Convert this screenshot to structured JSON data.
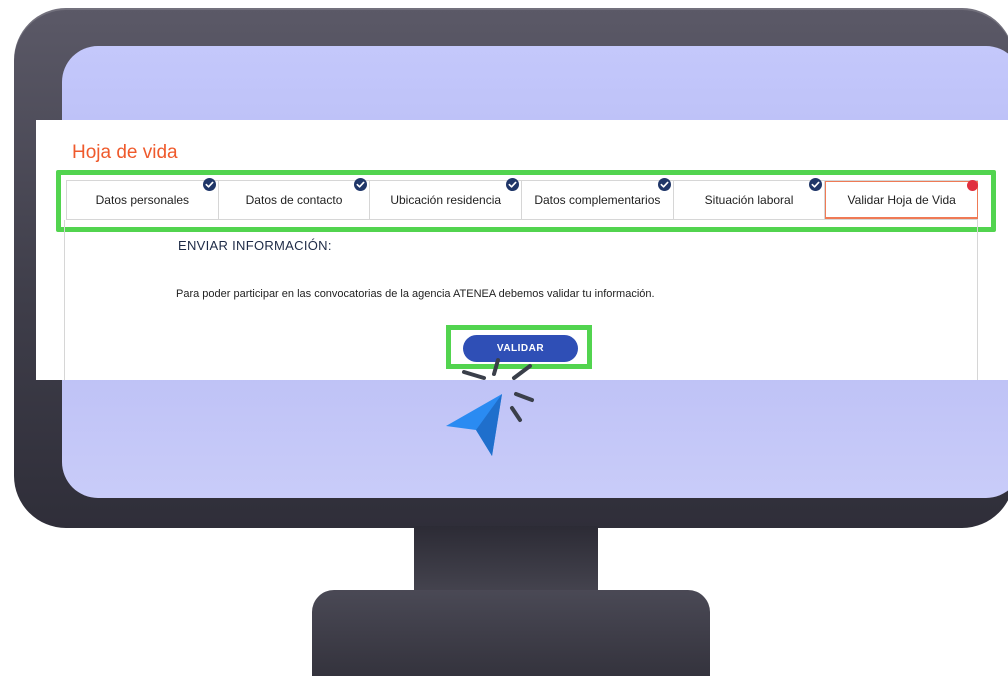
{
  "page": {
    "title": "Hoja de vida"
  },
  "tabs": [
    {
      "label": "Datos personales",
      "status": "complete"
    },
    {
      "label": "Datos de contacto",
      "status": "complete"
    },
    {
      "label": "Ubicación residencia",
      "status": "complete"
    },
    {
      "label": "Datos complementarios",
      "status": "complete"
    },
    {
      "label": "Situación laboral",
      "status": "complete"
    },
    {
      "label": "Validar Hoja de Vida",
      "status": "pending",
      "active": true
    }
  ],
  "section": {
    "heading": "ENVIAR INFORMACIÓN:",
    "description": "Para poder participar en las convocatorias de la agencia ATENEA debemos validar tu información."
  },
  "actions": {
    "validate_label": "VALIDAR"
  },
  "icons": {
    "complete": "check-circle-icon",
    "pending": "alert-dot-icon",
    "pointer": "cursor-arrow-icon"
  },
  "colors": {
    "accent_orange": "#ef5a2c",
    "highlight_green": "#52d44f",
    "button_blue": "#2f4fb6",
    "check_navy": "#1f3668",
    "alert_red": "#e0303e",
    "cursor_blue": "#2a8bf2",
    "screen_lavender": "#c4c8fb",
    "monitor_dark": "#3f3e4a"
  }
}
